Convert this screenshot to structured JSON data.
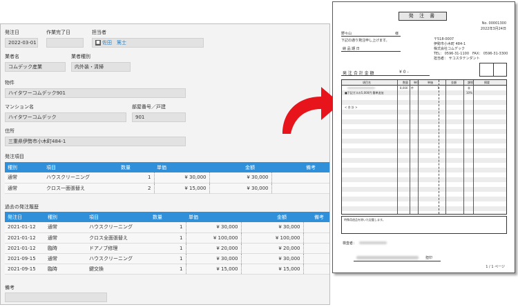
{
  "form": {
    "order_date_label": "発注日",
    "order_date": "2022-03-01",
    "work_done_label": "作業完了日",
    "work_done": "",
    "assignee_label": "担当者",
    "assignee": "佐田　篤士",
    "vendor_label": "業者名",
    "vendor": "コムデック産業",
    "vendor_type_label": "業者種別",
    "vendor_type": "内外装・清掃",
    "property_label": "物件",
    "property": "ハイタワーコムデック901",
    "mansion_label": "マンション名",
    "mansion": "ハイタワーコムデック",
    "room_label": "部屋番号／戸建",
    "room": "901",
    "address_label": "住所",
    "address": "三重県伊勢市小木町484-1",
    "items_label": "発注項目",
    "items_headers": [
      "種別",
      "項目",
      "数量",
      "単価",
      "金額",
      "備考"
    ],
    "items": [
      {
        "kind": "通常",
        "item": "ハウスクリーニング",
        "qty": "1",
        "price": "¥ 30,000",
        "amount": "¥ 30,000"
      },
      {
        "kind": "通常",
        "item": "クロス一面張替え",
        "qty": "2",
        "price": "¥ 15,000",
        "amount": "¥ 30,000"
      }
    ],
    "history_label": "過去の発注履歴",
    "history_headers": [
      "発注日",
      "種別",
      "項目",
      "数量",
      "単価",
      "金額",
      "備考"
    ],
    "history": [
      {
        "date": "2021-01-12",
        "kind": "通常",
        "item": "ハウスクリーニング",
        "qty": "1",
        "price": "¥ 30,000",
        "amount": "¥ 30,000"
      },
      {
        "date": "2021-01-12",
        "kind": "通常",
        "item": "クロス全面張替え",
        "qty": "1",
        "price": "¥ 100,000",
        "amount": "¥ 100,000"
      },
      {
        "date": "2021-01-12",
        "kind": "臨時",
        "item": "ドアノブ修理",
        "qty": "1",
        "price": "¥ 20,000",
        "amount": "¥ 20,000"
      },
      {
        "date": "2021-09-15",
        "kind": "通常",
        "item": "ハウスクリーニング",
        "qty": "1",
        "price": "¥ 30,000",
        "amount": "¥ 30,000"
      },
      {
        "date": "2021-09-15",
        "kind": "臨時",
        "item": "鍵交換",
        "qty": "1",
        "price": "¥ 15,000",
        "amount": "¥ 15,000"
      }
    ],
    "remarks_label": "備考",
    "remarks": ""
  },
  "doc": {
    "title": "発 注 書",
    "no": "No. 00001300",
    "date": "2022年3月24日",
    "addressee": "野々山",
    "honorific": "様",
    "intro": "下記の通り発注申し上げます。",
    "due_label": "納 品 期 日",
    "postal": "〒518-0007",
    "addr1": "伊勢市小木町 484-1",
    "company": "株式会社コムデック",
    "tel": "TEL： 0596-31-1100　FAX： 0596-31-3300",
    "staff": "担当者：  サコスタテンダント",
    "total_label": "発 注 合 計 金 額",
    "total_value": "¥ 0 -",
    "headers": [
      "項目名",
      "数量",
      "単位",
      "単価",
      "金額",
      "課税",
      "摘要"
    ],
    "row1_qty": "8,000",
    "row1_unit": "件",
    "row1_price": "7",
    "row1_tax1": "非",
    "row1_tax2": "10%",
    "row2_text": "■下記ガスの5,000円 簡単追加",
    "subtotal": "< 合 計 >",
    "note_label": "特殊用途品を除いた記載します。",
    "inspector_label": "検査者：",
    "stamp_label": "担印",
    "page": "1 / 1 ページ"
  }
}
